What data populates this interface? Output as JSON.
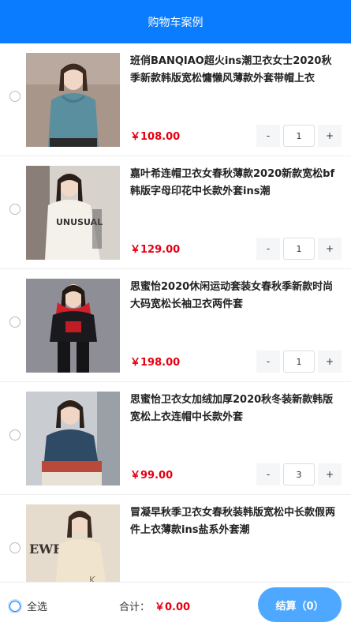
{
  "header": {
    "title": "购物车案例"
  },
  "items": [
    {
      "title": "班俏BANQIAO超火ins潮卫衣女士2020秋季新款韩版宽松慵懒风薄款外套带帽上衣",
      "price": "￥108.00",
      "qty": "1",
      "minus": "-",
      "plus": "+"
    },
    {
      "title": "嘉叶希连帽卫衣女春秋薄款2020新款宽松bf韩版字母印花中长款外套ins潮",
      "price": "￥129.00",
      "qty": "1",
      "minus": "-",
      "plus": "+"
    },
    {
      "title": "思蜜怡2020休闲运动套装女春秋季新款时尚大码宽松长袖卫衣两件套",
      "price": "￥198.00",
      "qty": "1",
      "minus": "-",
      "plus": "+"
    },
    {
      "title": "思蜜怡卫衣女加绒加厚2020秋冬装新款韩版宽松上衣连帽中长款外套",
      "price": "￥99.00",
      "qty": "3",
      "minus": "-",
      "plus": "+"
    },
    {
      "title": "冒凝早秋季卫衣女春秋装韩版宽松中长款假两件上衣薄款ins盐系外套潮",
      "price": "",
      "qty": "",
      "minus": "",
      "plus": ""
    }
  ],
  "footer": {
    "select_all": "全选",
    "total_label": "合计：",
    "total_amount": "￥0.00",
    "checkout": "结算（0）"
  },
  "colors": {
    "accent": "#0a7cff",
    "price": "#e60012",
    "checkout": "#4fa8ff"
  }
}
